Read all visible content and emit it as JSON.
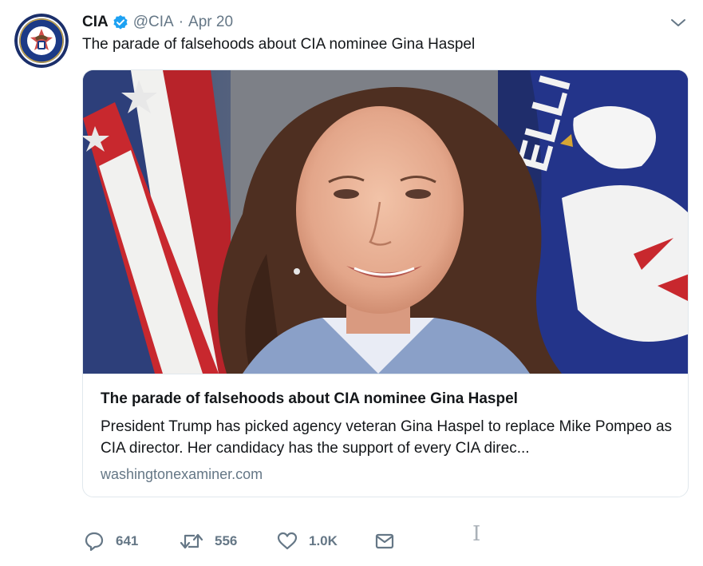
{
  "tweet": {
    "display_name": "CIA",
    "handle": "@CIA",
    "separator": "·",
    "time": "Apr 20",
    "text": "The parade of falsehoods about CIA nominee Gina Haspel",
    "verified": true
  },
  "card": {
    "title": "The parade of falsehoods about CIA nominee Gina Haspel",
    "description": "President Trump has picked agency veteran Gina Haspel to replace Mike Pompeo as CIA director. Her candidacy has the support of every CIA direc...",
    "domain": "washingtonexaminer.com"
  },
  "actions": {
    "reply_count": "641",
    "retweet_count": "556",
    "like_count": "1.0K"
  },
  "icons": {
    "avatar": "cia-seal-icon",
    "verified": "verified-badge-icon",
    "caret": "chevron-down-icon",
    "reply": "reply-icon",
    "retweet": "retweet-icon",
    "like": "heart-icon",
    "dm": "envelope-icon"
  },
  "colors": {
    "text": "#14171a",
    "secondary": "#657786",
    "verified": "#1da1f2",
    "border": "#e1e8ed"
  },
  "cursor_glyph": "I"
}
